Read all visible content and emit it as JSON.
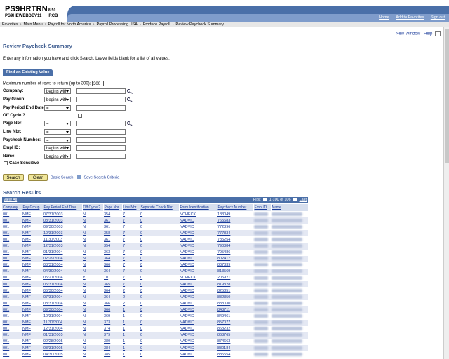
{
  "header": {
    "app_name": "PS9HRTRN",
    "app_version": "8.50",
    "server": "PS9HEWEBDEV11",
    "server_suffix": "RCB",
    "links": [
      "Home",
      "Add to Favorites",
      "Sign out"
    ]
  },
  "breadcrumb": [
    "Favorites",
    "Main Menu",
    "Payroll for North America",
    "Payroll Processing USA",
    "Produce Payroll",
    "Review Paycheck Summary"
  ],
  "page_links": {
    "new_window": "New Window",
    "separator": "|",
    "help": "Help"
  },
  "page": {
    "title": "Review Paycheck Summary",
    "instructions": "Enter any information you have and click Search. Leave fields blank for a list of all values."
  },
  "tab": {
    "label": "Find an Existing Value"
  },
  "search_form": {
    "max_rows_label": "Maximum number of rows to return (up to 300):",
    "max_rows_value": "300",
    "fields": [
      {
        "label": "Company:",
        "operator": "begins with",
        "value": "",
        "lookup": true
      },
      {
        "label": "Pay Group:",
        "operator": "begins with",
        "value": "",
        "lookup": true
      },
      {
        "label": "Pay Period End Date:",
        "operator": "=",
        "value": "",
        "lookup": false
      },
      {
        "label": "Off Cycle ?",
        "operator": "",
        "value": "",
        "lookup": false
      },
      {
        "label": "Page Nbr:",
        "operator": "=",
        "value": "",
        "lookup": true
      },
      {
        "label": "Line Nbr:",
        "operator": "=",
        "value": "",
        "lookup": false
      },
      {
        "label": "Paycheck Number:",
        "operator": "=",
        "value": "",
        "lookup": false
      },
      {
        "label": "Empl ID:",
        "operator": "begins with",
        "value": "",
        "lookup": false
      },
      {
        "label": "Name:",
        "operator": "begins with",
        "value": "",
        "lookup": false
      }
    ],
    "case_sensitive_label": "Case Sensitive",
    "search_button": "Search",
    "clear_button": "Clear",
    "basic_search_link": "Basic Search",
    "save_criteria_link": "Save Search Criteria"
  },
  "results": {
    "title": "Search Results",
    "view_all": "View All",
    "nav_first": "First",
    "nav_range": "1-100 of 106",
    "nav_last": "Last",
    "columns": [
      "Company",
      "Pay Group",
      "Pay Period End Date",
      "Off Cycle ?",
      "Page Nbr",
      "Line Nbr",
      "Separate Check Nbr",
      "Form Identification",
      "Paycheck Number",
      "Empl ID",
      "Name"
    ],
    "rows": [
      [
        "001",
        "NMF",
        "07/31/2003",
        "N",
        "354",
        "7",
        "0",
        "NCHECK",
        "183049"
      ],
      [
        "001",
        "NMF",
        "08/31/2003",
        "N",
        "361",
        "7",
        "0",
        "NADVIC",
        "765683"
      ],
      [
        "001",
        "NMF",
        "09/30/2003",
        "N",
        "361",
        "7",
        "0",
        "NADVIC",
        "772396"
      ],
      [
        "001",
        "NMF",
        "10/31/2003",
        "N",
        "358",
        "7",
        "0",
        "NADVIC",
        "777834"
      ],
      [
        "001",
        "NMF",
        "11/30/2003",
        "N",
        "361",
        "7",
        "0",
        "NADVIC",
        "785254"
      ],
      [
        "001",
        "NMF",
        "12/31/2003",
        "N",
        "354",
        "7",
        "0",
        "NADVIC",
        "790884"
      ],
      [
        "001",
        "NMF",
        "01/31/2004",
        "N",
        "363",
        "7",
        "0",
        "NADVIC",
        "795486"
      ],
      [
        "001",
        "NMF",
        "02/29/2004",
        "N",
        "364",
        "7",
        "0",
        "NADVIC",
        "802417"
      ],
      [
        "001",
        "NMF",
        "03/31/2004",
        "N",
        "366",
        "7",
        "0",
        "NADVIC",
        "807839"
      ],
      [
        "001",
        "NMF",
        "04/30/2004",
        "N",
        "364",
        "7",
        "0",
        "NADVIC",
        "813569"
      ],
      [
        "001",
        "NMF",
        "05/21/2004",
        "Y",
        "10",
        "7",
        "0",
        "NCHECK",
        "205921"
      ],
      [
        "001",
        "NMF",
        "05/31/2004",
        "N",
        "365",
        "7",
        "0",
        "NADVIC",
        "819328"
      ],
      [
        "001",
        "NMF",
        "06/30/2004",
        "N",
        "364",
        "2",
        "0",
        "NADVIC",
        "825851"
      ],
      [
        "001",
        "NMF",
        "07/31/2004",
        "N",
        "364",
        "2",
        "0",
        "NADVIC",
        "832350"
      ],
      [
        "001",
        "NMF",
        "08/31/2004",
        "N",
        "366",
        "2",
        "0",
        "NADVIC",
        "838030"
      ],
      [
        "001",
        "NMF",
        "09/30/2004",
        "N",
        "366",
        "1",
        "0",
        "NADVIC",
        "843711"
      ],
      [
        "001",
        "NMF",
        "10/31/2004",
        "N",
        "369",
        "1",
        "0",
        "NADVIC",
        "849461"
      ],
      [
        "001",
        "NMF",
        "11/30/2004",
        "N",
        "373",
        "1",
        "0",
        "NADVIC",
        "857077"
      ],
      [
        "001",
        "NMF",
        "12/31/2004",
        "N",
        "374",
        "1",
        "0",
        "NADVIC",
        "863232"
      ],
      [
        "001",
        "NMF",
        "01/31/2005",
        "N",
        "379",
        "1",
        "0",
        "NADVIC",
        "868765"
      ],
      [
        "001",
        "NMF",
        "02/28/2005",
        "N",
        "380",
        "1",
        "0",
        "NADVIC",
        "874663"
      ],
      [
        "001",
        "NMF",
        "03/31/2005",
        "N",
        "384",
        "1",
        "0",
        "NADVIC",
        "880184"
      ],
      [
        "001",
        "NMF",
        "04/30/2005",
        "N",
        "385",
        "1",
        "0",
        "NADVIC",
        "885554"
      ]
    ]
  }
}
